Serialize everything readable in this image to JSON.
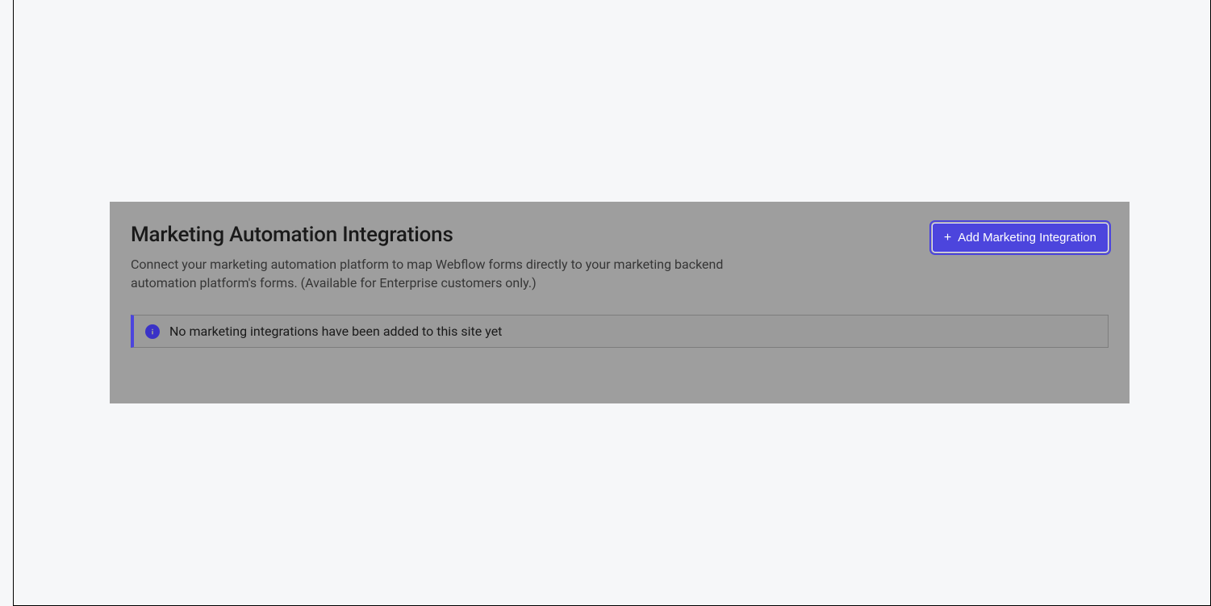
{
  "panel": {
    "title": "Marketing Automation Integrations",
    "description": "Connect your marketing automation platform to map Webflow forms directly to your marketing backend automation platform's forms. (Available for Enterprise customers only.)",
    "addButtonLabel": "Add Marketing Integration",
    "infoMessage": "No marketing integrations have been added to this site yet"
  }
}
